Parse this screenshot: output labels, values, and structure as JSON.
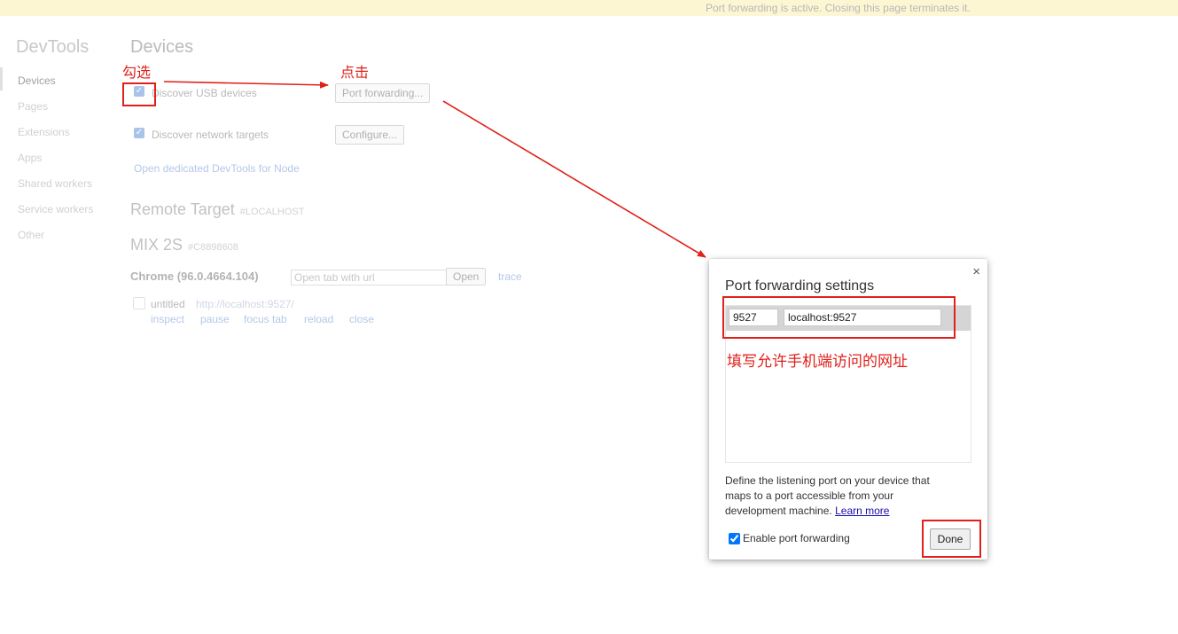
{
  "infobar": {
    "message": "Port forwarding is active. Closing this page terminates it."
  },
  "sidebar": {
    "title": "DevTools",
    "items": [
      {
        "label": "Devices"
      },
      {
        "label": "Pages"
      },
      {
        "label": "Extensions"
      },
      {
        "label": "Apps"
      },
      {
        "label": "Shared workers"
      },
      {
        "label": "Service workers"
      },
      {
        "label": "Other"
      }
    ]
  },
  "main": {
    "title": "Devices",
    "discover_usb": {
      "label": "Discover USB devices",
      "checked": true,
      "button": "Port forwarding..."
    },
    "discover_network": {
      "label": "Discover network targets",
      "checked": true,
      "button": "Configure..."
    },
    "node_link": "Open dedicated DevTools for Node",
    "remote_target": {
      "title": "Remote Target",
      "tag": "#LOCALHOST"
    },
    "device": {
      "name": "MIX 2S",
      "serial": "#C8898608"
    },
    "browser": {
      "name": "Chrome (96.0.4664.104)",
      "url_placeholder": "Open tab with url",
      "open_label": "Open",
      "trace_label": "trace"
    },
    "tab": {
      "title": "untitled",
      "url": "http://localhost:9527/",
      "actions": [
        "inspect",
        "pause",
        "focus tab",
        "reload",
        "close"
      ]
    }
  },
  "annotations": {
    "check_label": "勾选",
    "click_label": "点击",
    "fill_label": "填写允许手机端访问的网址"
  },
  "dialog": {
    "title": "Port forwarding settings",
    "close_glyph": "×",
    "rule": {
      "port": "9527",
      "address": "localhost:9527"
    },
    "description": "Define the listening port on your device that maps to a port accessible from your development machine.",
    "learn_more": "Learn more",
    "enable_label": "Enable port forwarding",
    "enable_checked": true,
    "done_label": "Done"
  },
  "colors": {
    "annotation_red": "#e0201a",
    "infobar_bg": "#fdf6d3"
  }
}
